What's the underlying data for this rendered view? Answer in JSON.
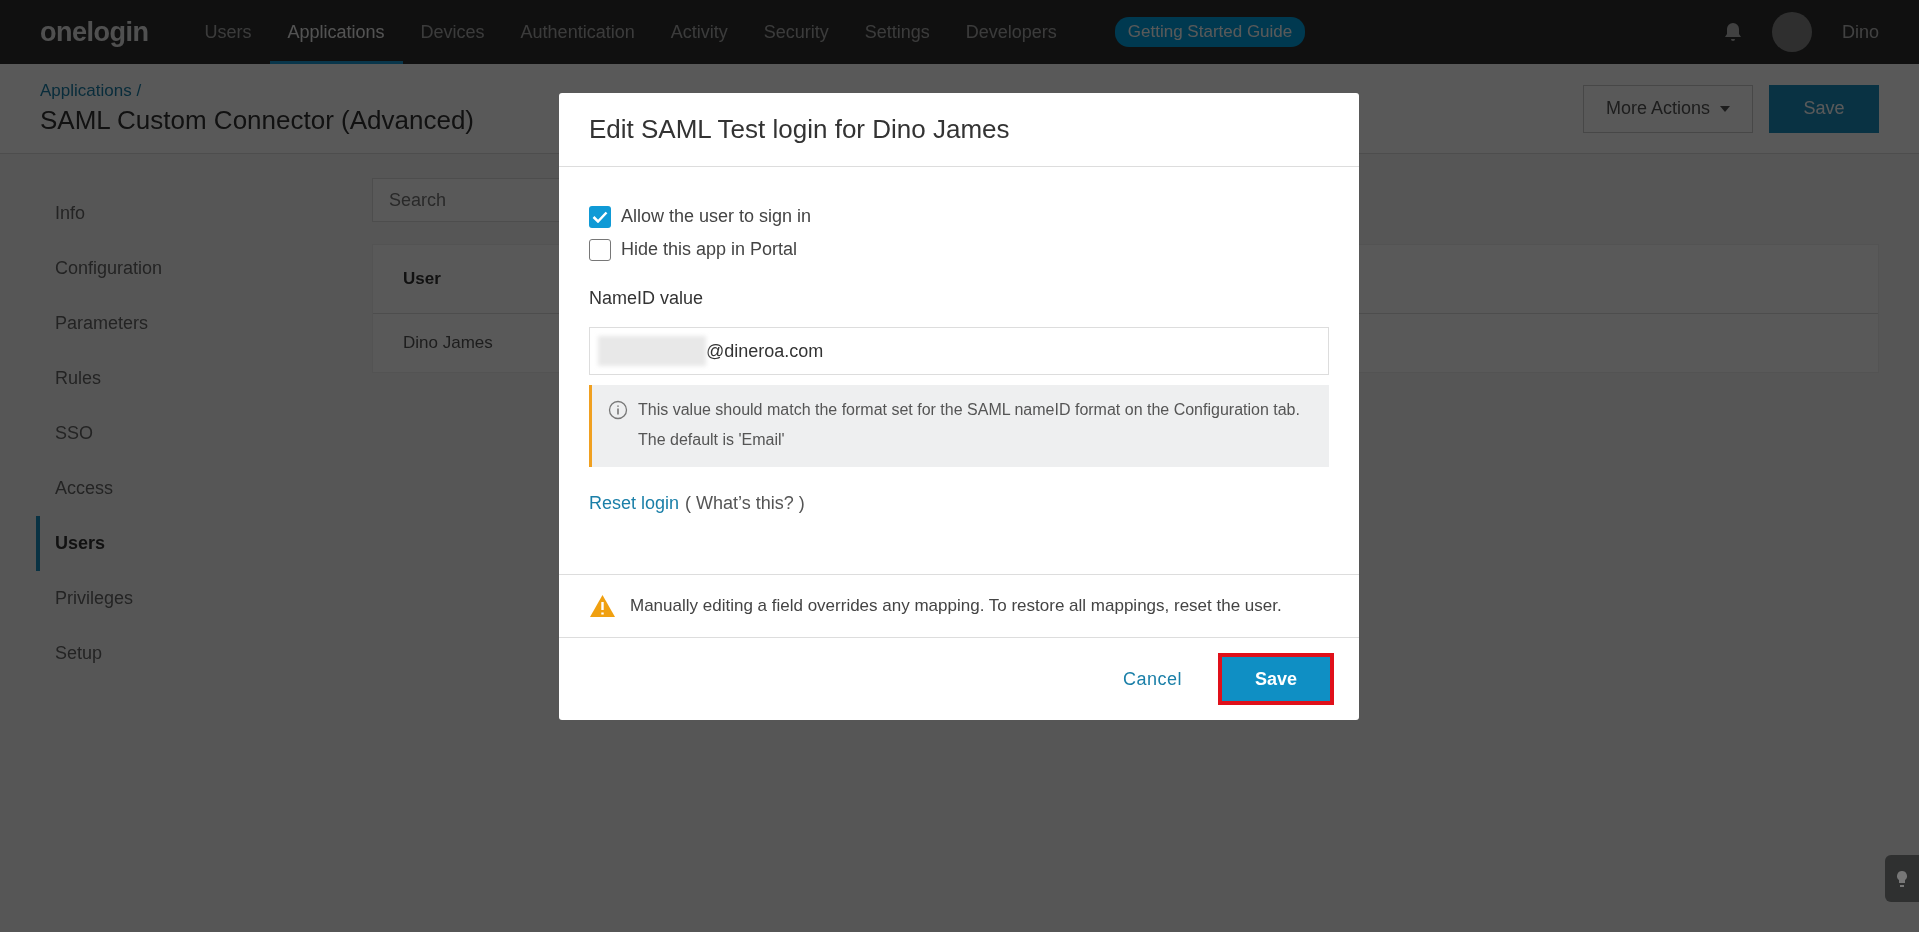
{
  "topbar": {
    "logo": "onelogin",
    "nav": [
      {
        "label": "Users",
        "selected": false
      },
      {
        "label": "Applications",
        "selected": true
      },
      {
        "label": "Devices",
        "selected": false
      },
      {
        "label": "Authentication",
        "selected": false
      },
      {
        "label": "Activity",
        "selected": false
      },
      {
        "label": "Security",
        "selected": false
      },
      {
        "label": "Settings",
        "selected": false
      },
      {
        "label": "Developers",
        "selected": false
      }
    ],
    "guide_button": "Getting Started Guide",
    "user_name": "Dino"
  },
  "header": {
    "breadcrumb": "Applications /",
    "title": "SAML Custom Connector (Advanced)",
    "more_actions": "More Actions",
    "save": "Save"
  },
  "sidebar": {
    "items": [
      {
        "label": "Info",
        "selected": false
      },
      {
        "label": "Configuration",
        "selected": false
      },
      {
        "label": "Parameters",
        "selected": false
      },
      {
        "label": "Rules",
        "selected": false
      },
      {
        "label": "SSO",
        "selected": false
      },
      {
        "label": "Access",
        "selected": false
      },
      {
        "label": "Users",
        "selected": true
      },
      {
        "label": "Privileges",
        "selected": false
      },
      {
        "label": "Setup",
        "selected": false
      }
    ]
  },
  "search": {
    "placeholder": "Search"
  },
  "table": {
    "columns": [
      "User"
    ],
    "rows": [
      [
        "Dino James"
      ]
    ]
  },
  "dialog": {
    "title": "Edit SAML Test login for Dino James",
    "checkboxes": [
      {
        "label": "Allow the user to sign in",
        "checked": true
      },
      {
        "label": "Hide this app in Portal",
        "checked": false
      }
    ],
    "nameid_label": "NameID value",
    "nameid_value": "@dineroa.com",
    "info": "This value should match the format set for the SAML nameID format on the Configuration tab. The default is 'Email'",
    "reset_link": "Reset login",
    "whats_this": "( What’s this? )",
    "warning": "Manually editing a field overrides any mapping. To restore all mappings, reset the user.",
    "cancel": "Cancel",
    "save": "Save",
    "save_highlighted": true
  }
}
